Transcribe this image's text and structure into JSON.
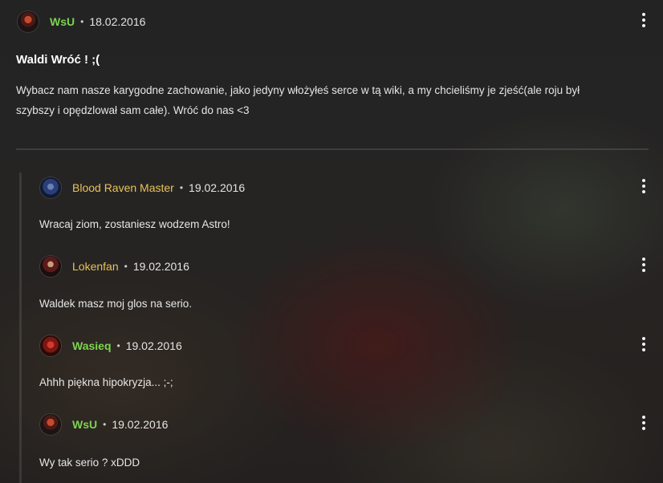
{
  "main_post": {
    "author": "WsU",
    "date": "18.02.2016",
    "title": "Waldi Wróć ! ;(",
    "body_line1": "Wybacz nam nasze karygodne zachowanie, jako jedyny włożyłeś serce w tą wiki, a my chcieliśmy je zjeść(ale roju był",
    "body_line2": "szybszy i opędzlował sam całe). Wróć do nas <3",
    "avatar_icon": "warrior-avatar-icon",
    "author_color": "#7cd44f"
  },
  "separator": "•",
  "replies": [
    {
      "author": "Blood Raven Master",
      "date": "19.02.2016",
      "text": "Wracaj ziom, zostaniesz wodzem Astro!",
      "author_color": "#e7c35a",
      "avatar_icon": "blood-raven-avatar-icon"
    },
    {
      "author": "Lokenfan",
      "date": "19.02.2016",
      "text": "Waldek masz moj glos na serio.",
      "author_color": "#e7c35a",
      "avatar_icon": "lokenfan-avatar-icon"
    },
    {
      "author": "Wasieq",
      "date": "19.02.2016",
      "text": "Ahhh piękna hipokryzja... ;-;",
      "author_color": "#7cd44f",
      "avatar_icon": "wasieq-avatar-icon"
    },
    {
      "author": "WsU",
      "date": "19.02.2016",
      "text": "Wy tak serio ? xDDD",
      "author_color": "#7cd44f",
      "avatar_icon": "warrior-avatar-icon"
    }
  ],
  "more_options_icon": "more-vertical-icon"
}
